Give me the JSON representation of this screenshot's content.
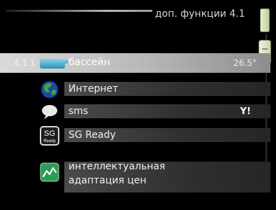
{
  "header": {
    "title": "доп. функции 4.1"
  },
  "menu": {
    "items": [
      {
        "code": "4.1.1",
        "label": "бассейн",
        "value": "26.5°",
        "icon": "pool-icon"
      },
      {
        "label": "Интернет",
        "icon": "globe-icon"
      },
      {
        "label": "sms",
        "icon": "speech-bubble-icon",
        "status_icon": "signal-icon",
        "status_text": "Y!"
      },
      {
        "label": "SG Ready",
        "icon": "sg-ready-icon",
        "badge_top": "SG",
        "badge_bottom": "Ready"
      },
      {
        "label_line1": "интеллектуальная",
        "label_line2": "адаптация цен",
        "icon": "price-chart-icon"
      }
    ]
  }
}
